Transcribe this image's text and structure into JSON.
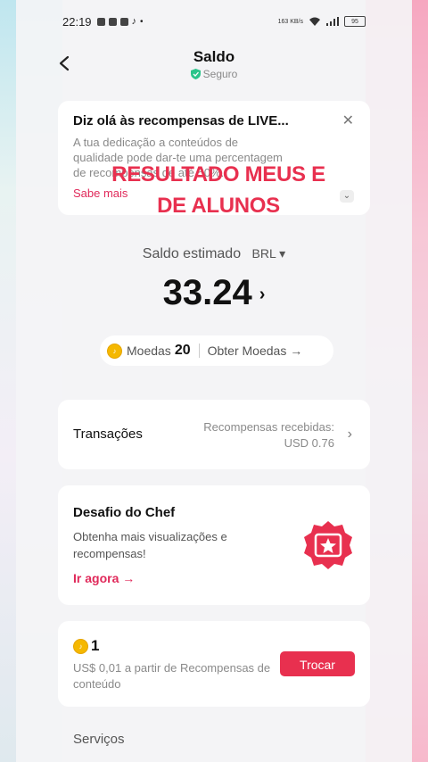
{
  "status": {
    "time": "22:19",
    "net_speed": "163 KB/s",
    "battery": "95"
  },
  "header": {
    "title": "Saldo",
    "secure_label": "Seguro"
  },
  "promo": {
    "title": "Diz olá às recompensas de LIVE...",
    "text": "A tua dedicação a conteúdos de qualidade pode dar-te uma percentagem de recompensas de até 50%.",
    "link": "Sabe mais"
  },
  "overlay": {
    "line1": "RESULTADO MEUS E",
    "line2": "DE ALUNOS"
  },
  "balance": {
    "label": "Saldo estimado",
    "currency": "BRL",
    "value": "33.24"
  },
  "coins_bar": {
    "label": "Moedas",
    "count": "20",
    "get_label": "Obter Moedas →"
  },
  "transactions": {
    "label": "Transações",
    "rewards_line1": "Recompensas recebidas:",
    "rewards_line2": "USD 0.76"
  },
  "chef": {
    "title": "Desafio do Chef",
    "text": "Obtenha mais visualizações e recompensas!",
    "link": "Ir agora →"
  },
  "coin_card": {
    "value": "1",
    "text": "US$ 0,01 a partir de Recompensas de conteúdo",
    "button": "Trocar"
  },
  "services_label": "Serviços",
  "colors": {
    "accent": "#e0295a",
    "overlay": "#e8304f",
    "coin": "#f5b800"
  }
}
